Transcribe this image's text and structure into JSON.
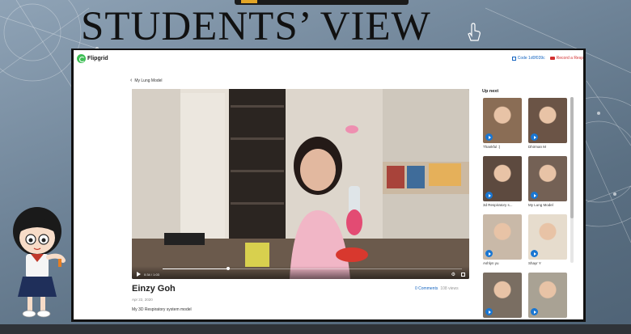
{
  "slide": {
    "title": "STUDENTS’ VIEW"
  },
  "app": {
    "logo_text": "Flipgrid",
    "code_label": "Code 1d0f039c",
    "record_label": "Record a Resp"
  },
  "breadcrumb": {
    "label": "My Lung Model"
  },
  "video": {
    "time": "0:34 / 1:03",
    "progress": 0.22
  },
  "response": {
    "author": "Einzy Goh",
    "date": "Apr 22, 2020",
    "description": "My 3D Respiratory system model",
    "comments": "0 Comments",
    "views": "108 views"
  },
  "up_next": {
    "heading": "Up next",
    "items": [
      {
        "label": "Thankful :)",
        "color": "#8a6d55"
      },
      {
        "label": "Dhirman M",
        "color": "#6b5446"
      },
      {
        "label": "3d Respiratory s...",
        "color": "#5d4a3f"
      },
      {
        "label": "My Lung Model",
        "color": "#746155"
      },
      {
        "label": "Ashlyn yu",
        "color": "#c9b9a8"
      },
      {
        "label": "Shayr Y",
        "color": "#e6dccd"
      },
      {
        "label": "",
        "color": "#7a6e62"
      },
      {
        "label": "",
        "color": "#a9a294"
      }
    ]
  },
  "colors": {
    "accent": "#1565c0",
    "record": "#d32f2f",
    "brand": "#3fbf56"
  }
}
